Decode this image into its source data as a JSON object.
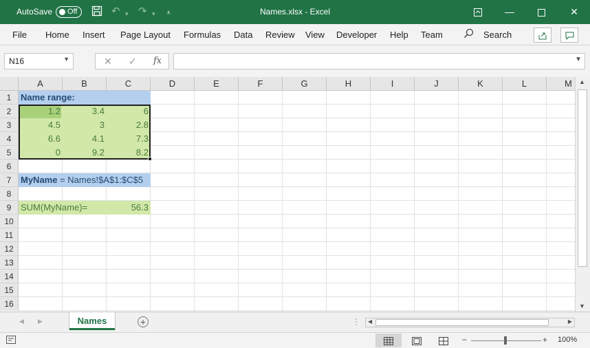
{
  "titlebar": {
    "autosave_label": "AutoSave",
    "autosave_state": "Off",
    "title": "Names.xlsx  -  Excel"
  },
  "ribbon": {
    "tabs": [
      "File",
      "Home",
      "Insert",
      "Page Layout",
      "Formulas",
      "Data",
      "Review",
      "View",
      "Developer",
      "Help",
      "Team"
    ],
    "search_label": "Search"
  },
  "formula_bar": {
    "name_box": "N16",
    "fx": "fx",
    "content": ""
  },
  "grid": {
    "columns": [
      "A",
      "B",
      "C",
      "D",
      "E",
      "F",
      "G",
      "H",
      "I",
      "J",
      "K",
      "L",
      "M"
    ],
    "rows": [
      "1",
      "2",
      "3",
      "4",
      "5",
      "6",
      "7",
      "8",
      "9",
      "10",
      "11",
      "12",
      "13",
      "14",
      "15",
      "16"
    ],
    "a1": "Name range:",
    "data": [
      [
        "1.2",
        "3.4",
        "6"
      ],
      [
        "4.5",
        "3",
        "2.8"
      ],
      [
        "6.6",
        "4.1",
        "7.3"
      ],
      [
        "0",
        "9.2",
        "8.2"
      ]
    ],
    "a7_bold": "MyName",
    "a7_rest": " = Names!$A$1:$C$5",
    "a9": "SUM(MyName)=",
    "c9": "56.3"
  },
  "sheets": {
    "active": "Names"
  },
  "status": {
    "zoom": "100%"
  },
  "colors": {
    "excel_green": "#217346",
    "cell_green": "#d1e8a8",
    "cell_blue": "#b4cfee"
  }
}
